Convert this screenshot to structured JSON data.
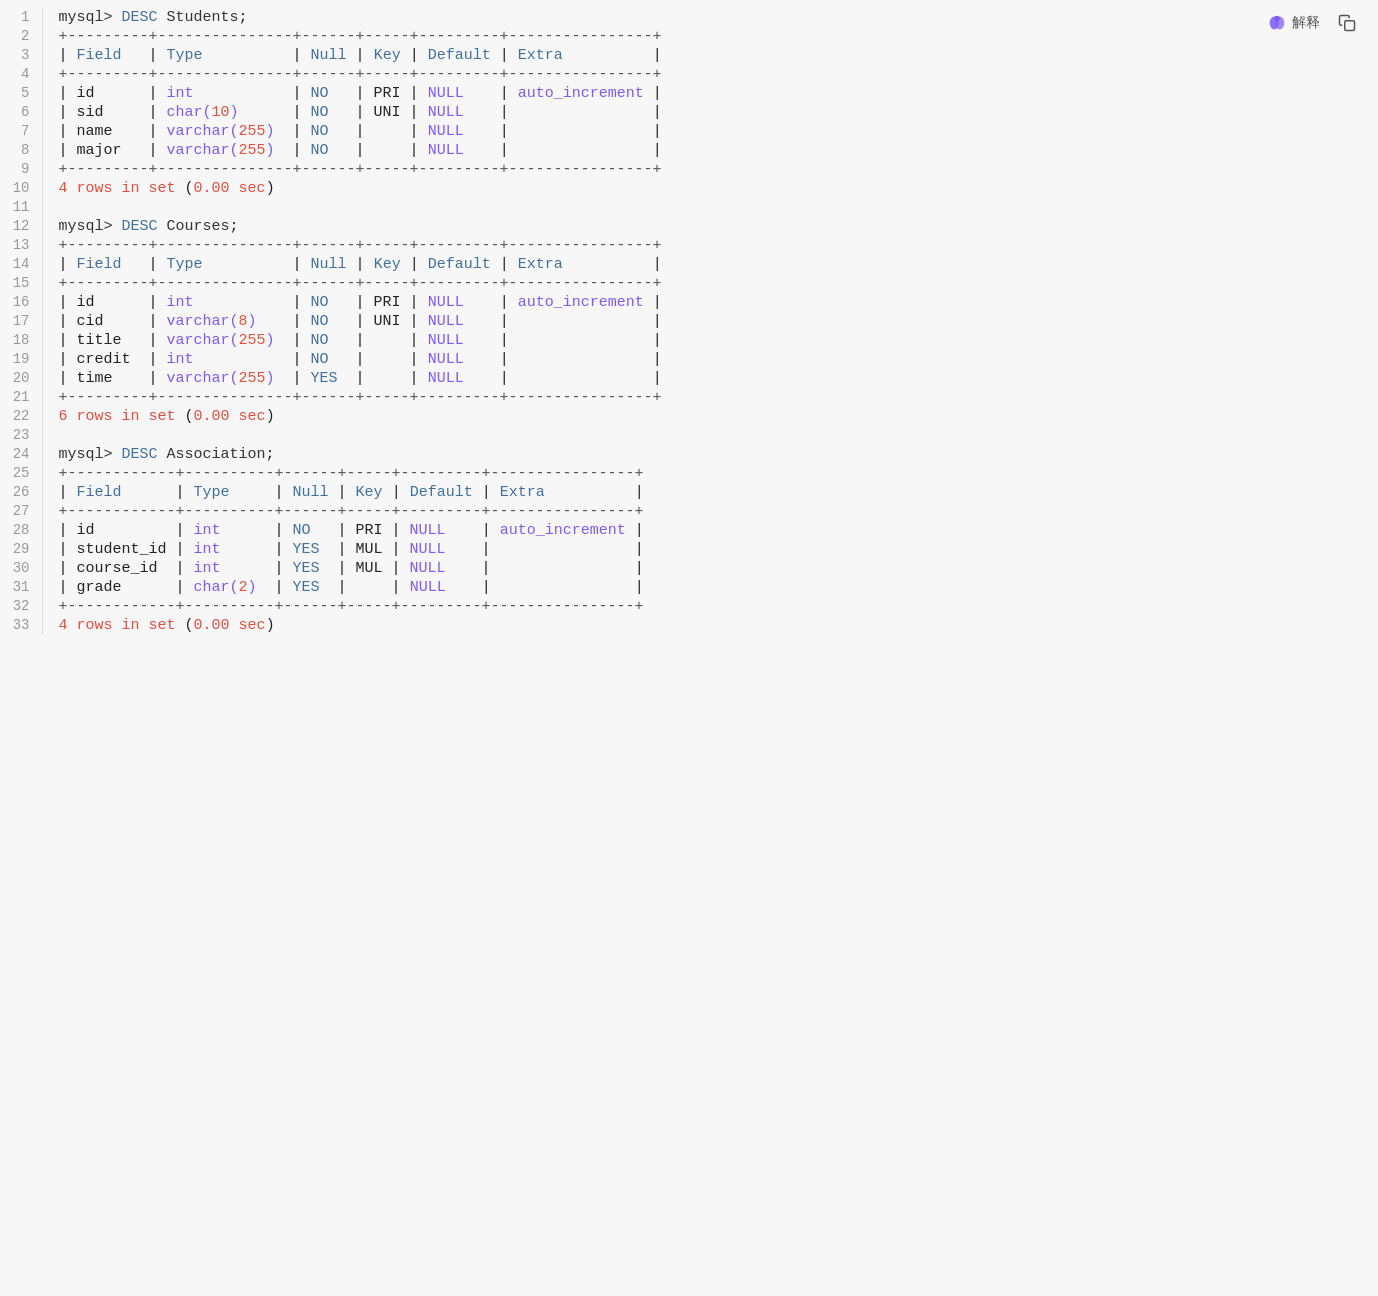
{
  "toolbar": {
    "explain_label": "解释",
    "copy_label": "复制"
  },
  "lines": [
    {
      "num": 1,
      "content": "mysql> DESC Students;"
    },
    {
      "num": 2,
      "content": "+---------+---------------+------+-----+---------+----------------+"
    },
    {
      "num": 3,
      "content": "| Field   | Type          | Null | Key | Default | Extra          |"
    },
    {
      "num": 4,
      "content": "+---------+---------------+------+-----+---------+----------------+"
    },
    {
      "num": 5,
      "content": "| id      | int           | NO   | PRI | NULL    | auto_increment |"
    },
    {
      "num": 6,
      "content": "| sid     | char(10)      | NO   | UNI | NULL    |                |"
    },
    {
      "num": 7,
      "content": "| name    | varchar(255)  | NO   |     | NULL    |                |"
    },
    {
      "num": 8,
      "content": "| major   | varchar(255)  | NO   |     | NULL    |                |"
    },
    {
      "num": 9,
      "content": "+---------+---------------+------+-----+---------+----------------+"
    },
    {
      "num": 10,
      "content": "4 rows in set (0.00 sec)"
    },
    {
      "num": 11,
      "content": ""
    },
    {
      "num": 12,
      "content": "mysql> DESC Courses;"
    },
    {
      "num": 13,
      "content": "+---------+---------------+------+-----+---------+----------------+"
    },
    {
      "num": 14,
      "content": "| Field   | Type          | Null | Key | Default | Extra          |"
    },
    {
      "num": 15,
      "content": "+---------+---------------+------+-----+---------+----------------+"
    },
    {
      "num": 16,
      "content": "| id      | int           | NO   | PRI | NULL    | auto_increment |"
    },
    {
      "num": 17,
      "content": "| cid     | varchar(8)    | NO   | UNI | NULL    |                |"
    },
    {
      "num": 18,
      "content": "| title   | varchar(255)  | NO   |     | NULL    |                |"
    },
    {
      "num": 19,
      "content": "| credit  | int           | NO   |     | NULL    |                |"
    },
    {
      "num": 20,
      "content": "| time    | varchar(255)  | YES  |     | NULL    |                |"
    },
    {
      "num": 21,
      "content": "+---------+---------------+------+-----+---------+----------------+"
    },
    {
      "num": 22,
      "content": "6 rows in set (0.00 sec)"
    },
    {
      "num": 23,
      "content": ""
    },
    {
      "num": 24,
      "content": "mysql> DESC Association;"
    },
    {
      "num": 25,
      "content": "+------------+----------+------+-----+---------+----------------+"
    },
    {
      "num": 26,
      "content": "| Field      | Type     | Null | Key | Default | Extra          |"
    },
    {
      "num": 27,
      "content": "+------------+----------+------+-----+---------+----------------+"
    },
    {
      "num": 28,
      "content": "| id         | int      | NO   | PRI | NULL    | auto_increment |"
    },
    {
      "num": 29,
      "content": "| student_id | int      | YES  | MUL | NULL    |                |"
    },
    {
      "num": 30,
      "content": "| course_id  | int      | YES  | MUL | NULL    |                |"
    },
    {
      "num": 31,
      "content": "| grade      | char(2)  | YES  |     | NULL    |                |"
    },
    {
      "num": 32,
      "content": "+------------+----------+------+-----+---------+----------------+"
    },
    {
      "num": 33,
      "content": "4 rows in set (0.00 sec)"
    }
  ]
}
